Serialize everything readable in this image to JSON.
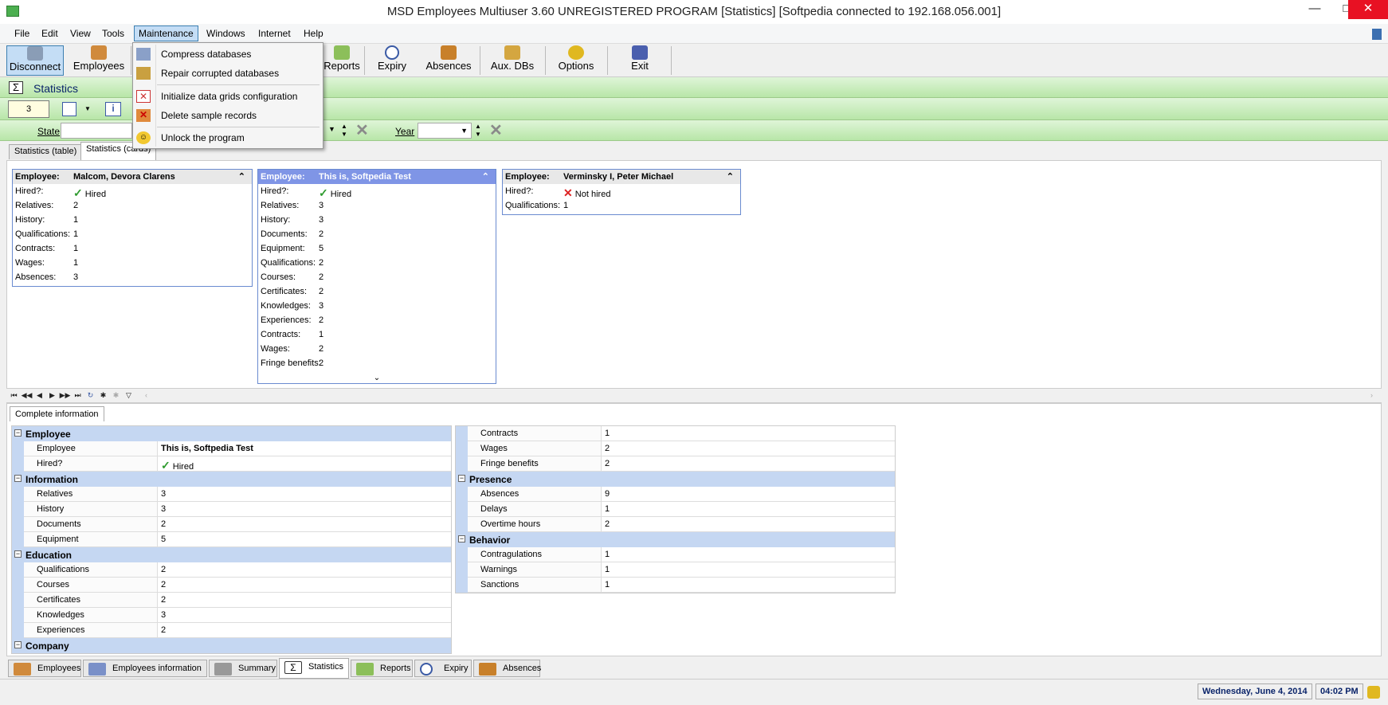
{
  "window": {
    "title": "MSD Employees Multiuser 3.60 UNREGISTERED PROGRAM [Statistics] [Softpedia connected to 192.168.056.001]",
    "minimize": "—",
    "maximize": "□",
    "close": "✕"
  },
  "menubar": [
    "File",
    "Edit",
    "View",
    "Tools",
    "Maintenance",
    "Windows",
    "Internet",
    "Help"
  ],
  "maintenance_menu": [
    "Compress databases",
    "Repair corrupted databases",
    "Initialize data grids configuration",
    "Delete sample records",
    "Unlock the program"
  ],
  "toolbar": {
    "disconnect": "Disconnect",
    "employees": "Employees",
    "reports": "Reports",
    "expiry": "Expiry",
    "absences": "Absences",
    "auxdbs": "Aux. DBs",
    "options": "Options",
    "exit": "Exit"
  },
  "statistics_label": "Statistics",
  "record_number": "3",
  "filters": {
    "state": "State",
    "year": "Year"
  },
  "top_tabs": [
    "Statistics (table)",
    "Statistics (cards)"
  ],
  "cards": [
    {
      "employee_key": "Employee:",
      "employee": "Malcom, Devora Clarens",
      "hired_key": "Hired?:",
      "hired": "Hired",
      "rows": [
        {
          "k": "Relatives:",
          "v": "2"
        },
        {
          "k": "History:",
          "v": "1"
        },
        {
          "k": "Qualifications:",
          "v": "1"
        },
        {
          "k": "Contracts:",
          "v": "1"
        },
        {
          "k": "Wages:",
          "v": "1"
        },
        {
          "k": "Absences:",
          "v": "3"
        }
      ]
    },
    {
      "employee_key": "Employee:",
      "employee": "This is, Softpedia Test",
      "hired_key": "Hired?:",
      "hired": "Hired",
      "rows": [
        {
          "k": "Relatives:",
          "v": "3"
        },
        {
          "k": "History:",
          "v": "3"
        },
        {
          "k": "Documents:",
          "v": "2"
        },
        {
          "k": "Equipment:",
          "v": "5"
        },
        {
          "k": "Qualifications:",
          "v": "2"
        },
        {
          "k": "Courses:",
          "v": "2"
        },
        {
          "k": "Certificates:",
          "v": "2"
        },
        {
          "k": "Knowledges:",
          "v": "3"
        },
        {
          "k": "Experiences:",
          "v": "2"
        },
        {
          "k": "Contracts:",
          "v": "1"
        },
        {
          "k": "Wages:",
          "v": "2"
        },
        {
          "k": "Fringe benefits:",
          "v": "2"
        }
      ]
    },
    {
      "employee_key": "Employee:",
      "employee": "Verminsky I, Peter Michael",
      "hired_key": "Hired?:",
      "hired": "Not hired",
      "rows": [
        {
          "k": "Qualifications:",
          "v": "1"
        }
      ]
    }
  ],
  "detail_tab": "Complete information",
  "detail_left": [
    {
      "type": "cat",
      "title": "Employee"
    },
    {
      "type": "item",
      "k": "Employee",
      "v": "This is, Softpedia Test",
      "bold": true
    },
    {
      "type": "item",
      "k": "Hired?",
      "v": "Hired",
      "check": true
    },
    {
      "type": "cat",
      "title": "Information"
    },
    {
      "type": "item",
      "k": "Relatives",
      "v": "3"
    },
    {
      "type": "item",
      "k": "History",
      "v": "3"
    },
    {
      "type": "item",
      "k": "Documents",
      "v": "2"
    },
    {
      "type": "item",
      "k": "Equipment",
      "v": "5"
    },
    {
      "type": "cat",
      "title": "Education"
    },
    {
      "type": "item",
      "k": "Qualifications",
      "v": "2"
    },
    {
      "type": "item",
      "k": "Courses",
      "v": "2"
    },
    {
      "type": "item",
      "k": "Certificates",
      "v": "2"
    },
    {
      "type": "item",
      "k": "Knowledges",
      "v": "3"
    },
    {
      "type": "item",
      "k": "Experiences",
      "v": "2"
    },
    {
      "type": "cat",
      "title": "Company"
    }
  ],
  "detail_right": [
    {
      "type": "item",
      "k": "Contracts",
      "v": "1"
    },
    {
      "type": "item",
      "k": "Wages",
      "v": "2"
    },
    {
      "type": "item",
      "k": "Fringe benefits",
      "v": "2"
    },
    {
      "type": "cat",
      "title": "Presence"
    },
    {
      "type": "item",
      "k": "Absences",
      "v": "9"
    },
    {
      "type": "item",
      "k": "Delays",
      "v": "1"
    },
    {
      "type": "item",
      "k": "Overtime hours",
      "v": "2"
    },
    {
      "type": "cat",
      "title": "Behavior"
    },
    {
      "type": "item",
      "k": "Contragulations",
      "v": "1"
    },
    {
      "type": "item",
      "k": "Warnings",
      "v": "1"
    },
    {
      "type": "item",
      "k": "Sanctions",
      "v": "1"
    }
  ],
  "bottom_tabs": [
    "Employees",
    "Employees information",
    "Summary",
    "Statistics",
    "Reports",
    "Expiry",
    "Absences"
  ],
  "status": {
    "date": "Wednesday, June 4, 2014",
    "time": "04:02 PM"
  },
  "colors": {
    "accent": "#7f95e6",
    "green": "#b8e6a8",
    "header_blue": "#c5d7f2"
  }
}
